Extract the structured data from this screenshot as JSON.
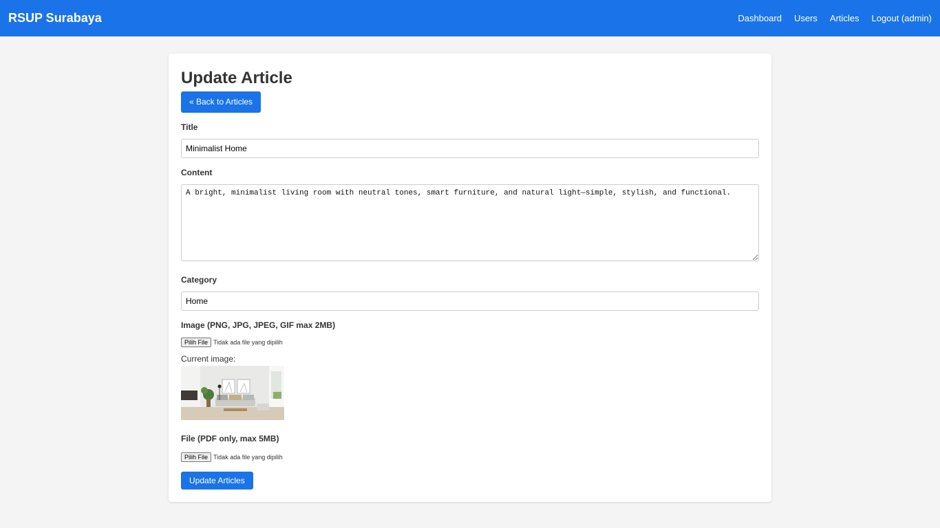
{
  "nav": {
    "brand": "RSUP Surabaya",
    "links": [
      "Dashboard",
      "Users",
      "Articles",
      "Logout (admin)"
    ]
  },
  "page": {
    "title": "Update Article",
    "back_label": "« Back to Articles"
  },
  "form": {
    "title_label": "Title",
    "title_value": "Minimalist Home",
    "content_label": "Content",
    "content_value": "A bright, minimalist living room with neutral tones, smart furniture, and natural light—simple, stylish, and functional.",
    "category_label": "Category",
    "category_value": "Home",
    "image_label": "Image (PNG, JPG, JPEG, GIF max 2MB)",
    "image_file_button": "Pilih File",
    "image_file_status": "Tidak ada file yang dipilih",
    "current_image_label": "Current image:",
    "file_label": "File (PDF only, max 5MB)",
    "file_button": "Pilih File",
    "file_status": "Tidak ada file yang dipilih",
    "submit_label": "Update Articles"
  },
  "colors": {
    "primary": "#1a73e8",
    "background": "#f4f4f4",
    "card": "#ffffff"
  }
}
